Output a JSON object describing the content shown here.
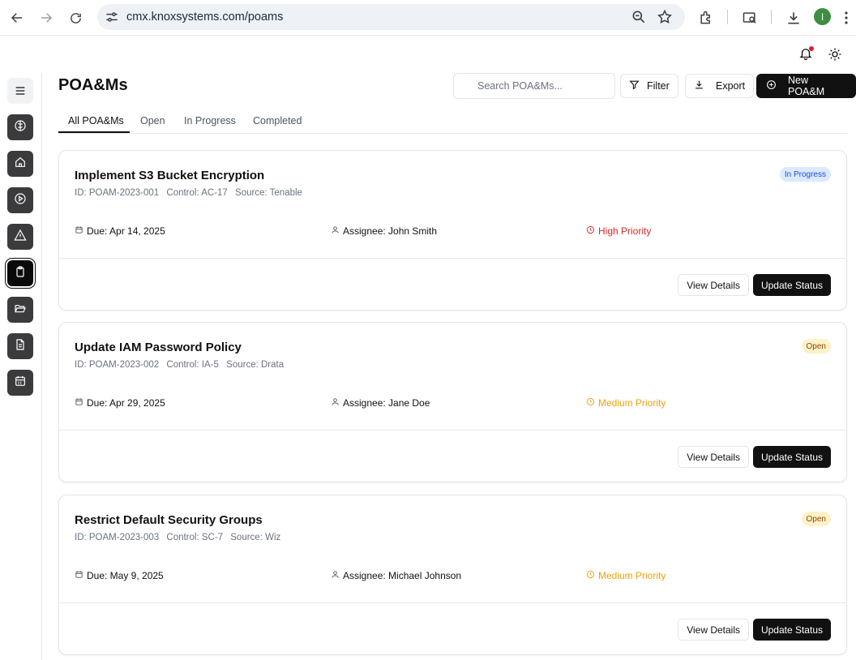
{
  "browser": {
    "url": "cmx.knoxsystems.com/poams",
    "profile_initial": "I"
  },
  "header": {
    "title": "POA&Ms",
    "search_placeholder": "Search POA&Ms...",
    "filter_label": "Filter",
    "export_label": "Export",
    "new_label": "New POA&M"
  },
  "tabs": [
    {
      "label": "All POA&Ms"
    },
    {
      "label": "Open"
    },
    {
      "label": "In Progress"
    },
    {
      "label": "Completed"
    }
  ],
  "cards": [
    {
      "title": "Implement S3 Bucket Encryption",
      "id": "ID: POAM-2023-001",
      "control": "Control: AC-17",
      "source": "Source: Tenable",
      "status": "In Progress",
      "due": "Due: Apr 14, 2025",
      "assignee": "Assignee: John Smith",
      "priority": "High Priority",
      "view_label": "View Details",
      "update_label": "Update Status"
    },
    {
      "title": "Update IAM Password Policy",
      "id": "ID: POAM-2023-002",
      "control": "Control: IA-5",
      "source": "Source: Drata",
      "status": "Open",
      "due": "Due: Apr 29, 2025",
      "assignee": "Assignee: Jane Doe",
      "priority": "Medium Priority",
      "view_label": "View Details",
      "update_label": "Update Status"
    },
    {
      "title": "Restrict Default Security Groups",
      "id": "ID: POAM-2023-003",
      "control": "Control: SC-7",
      "source": "Source: Wiz",
      "status": "Open",
      "due": "Due: May 9, 2025",
      "assignee": "Assignee: Michael Johnson",
      "priority": "Medium Priority",
      "view_label": "View Details",
      "update_label": "Update Status"
    }
  ],
  "colors": {
    "high_priority": "#dc2626",
    "medium_priority": "#f59e0b",
    "in_progress_badge": "#dbeafe",
    "open_badge": "#fef3c7",
    "primary_button": "#111111",
    "notification_dot": "#e11d2a"
  }
}
